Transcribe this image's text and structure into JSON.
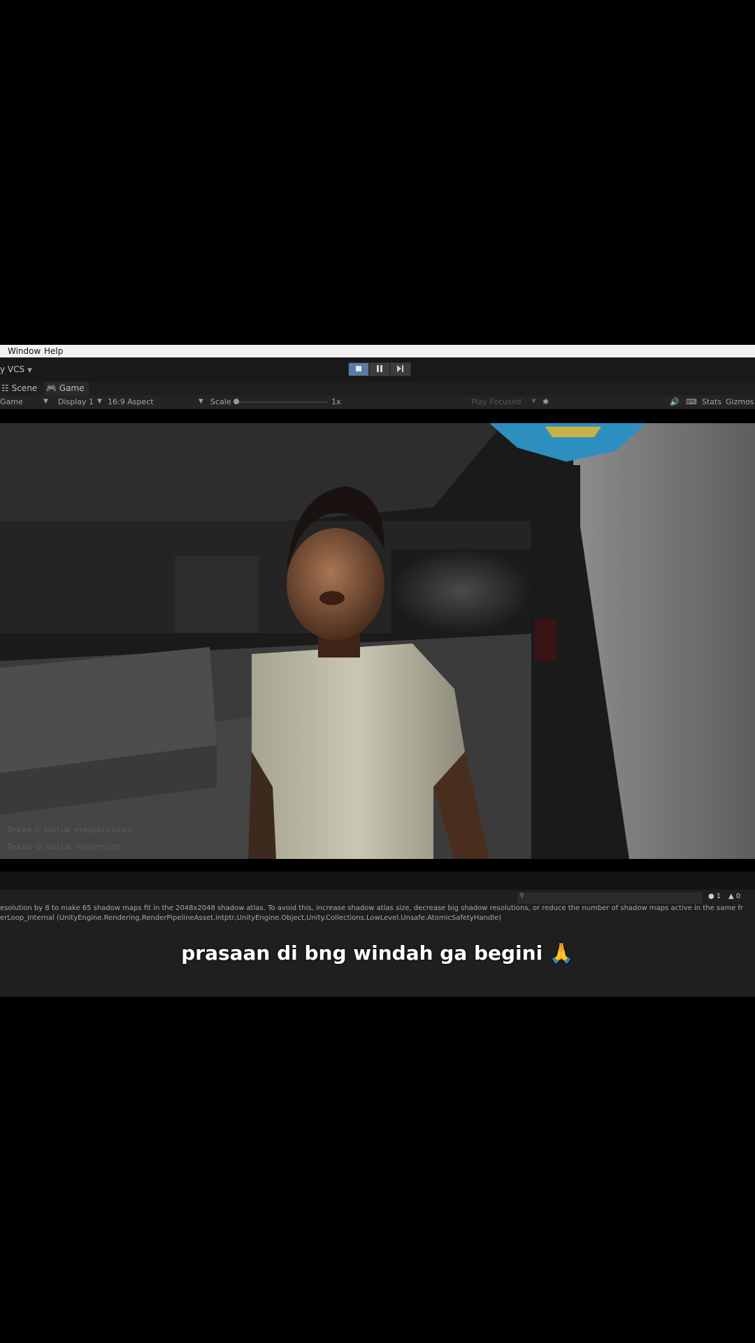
{
  "menu": {
    "items": [
      "Window",
      "Help"
    ]
  },
  "toolbar": {
    "vcs_label": "y VCS"
  },
  "tabs": [
    {
      "label": "Scene",
      "icon": "hash-icon"
    },
    {
      "label": "Game",
      "icon": "gamepad-icon"
    }
  ],
  "game_toolbar": {
    "mode": "Game",
    "display": "Display 1",
    "aspect": "16:9 Aspect",
    "scale_label": "Scale",
    "scale_value": "1x",
    "play_mode": "Play Focused",
    "stats": "Stats",
    "gizmos": "Gizmos"
  },
  "viewport": {
    "hint_1": "Tekan C Untuk menjatuhkan",
    "hint_2": "Tekan G Untuk melempar"
  },
  "console": {
    "counts": {
      "info": "1",
      "warning": "0"
    },
    "line_1": "esolution by 8 to make 65 shadow maps fit in the 2048x2048 shadow atlas. To avoid this, increase shadow atlas size, decrease big shadow resolutions, or reduce the number of shadow maps active in the same fr",
    "line_2": "erLoop_Internal (UnityEngine.Rendering.RenderPipelineAsset,intptr,UnityEngine.Object,Unity.Collections.LowLevel.Unsafe.AtomicSafetyHandle)"
  },
  "caption": "prasaan di bng windah ga begini 🙏"
}
